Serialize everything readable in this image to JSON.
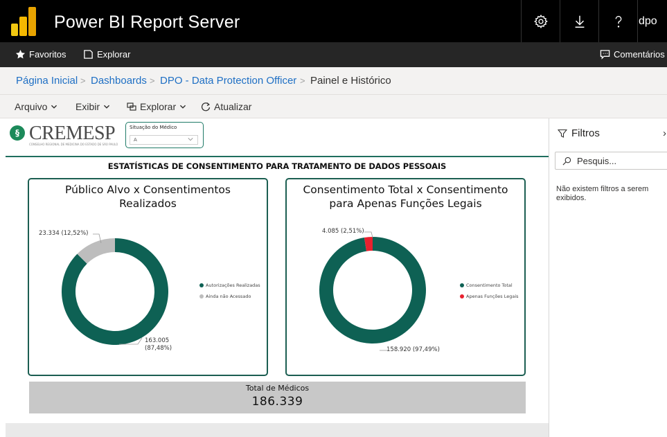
{
  "app": {
    "title": "Power BI Report Server",
    "user": "dpo"
  },
  "nav": {
    "favorites": "Favoritos",
    "explore": "Explorar",
    "comments": "Comentários"
  },
  "breadcrumb": {
    "home": "Página Inicial",
    "dashboards": "Dashboards",
    "folder": "DPO - Data Protection Officer",
    "current": "Painel e Histórico",
    "separator": ">"
  },
  "toolbar": {
    "file": "Arquivo",
    "view": "Exibir",
    "explore": "Explorar",
    "refresh": "Atualizar"
  },
  "report": {
    "logo_text": "CREMESP",
    "logo_subtitle": "CONSELHO REGIONAL DE MEDICINA DO ESTADO DE SÃO PAULO",
    "slicer": {
      "label": "Situação do Médico",
      "value": "A"
    },
    "title": "ESTATÍSTICAS DE CONSENTIMENTO PARA TRATAMENTO DE DADOS PESSOAIS",
    "total": {
      "label": "Total de Médicos",
      "value": "186.339"
    }
  },
  "chart_data": [
    {
      "type": "pie",
      "variant": "donut",
      "title_line1": "Público Alvo x Consentimentos",
      "title_line2": "Realizados",
      "categories": [
        "Autorizações Realizadas",
        "Ainda não Acessado"
      ],
      "values": [
        163005,
        23334
      ],
      "labels": [
        "163.005 (87,48%)",
        "23.334 (12,52%)"
      ],
      "label_lines": [
        [
          "163.005",
          "(87,48%)"
        ],
        [
          "23.334 (12,52%)"
        ]
      ],
      "colors": [
        "#0e6154",
        "#bdbdbd"
      ],
      "legend": "right"
    },
    {
      "type": "pie",
      "variant": "donut",
      "title_line1": "Consentimento Total x Consentimento",
      "title_line2": "para Apenas Funções Legais",
      "categories": [
        "Consentimento Total",
        "Apenas Funções Legais"
      ],
      "values": [
        158920,
        4085
      ],
      "labels": [
        "158.920 (97,49%)",
        "4.085 (2,51%)"
      ],
      "label_lines": [
        [
          "158.920 (97,49%)"
        ],
        [
          "4.085 (2,51%)"
        ]
      ],
      "colors": [
        "#0e6154",
        "#e8212f"
      ],
      "legend": "right"
    }
  ],
  "filters": {
    "title": "Filtros",
    "search_placeholder": "Pesquis...",
    "empty_message": "Não existem filtros a serem exibidos."
  },
  "colors": {
    "topbar": "#000000",
    "navbar": "#262626",
    "accent": "#0e6154",
    "link": "#1e6fc4"
  },
  "icons": [
    "power-bi-logo-icon",
    "gear-icon",
    "download-icon",
    "help-icon",
    "star-icon",
    "explore-icon",
    "comment-icon",
    "chevron-down-icon",
    "refresh-icon",
    "filter-icon",
    "search-icon"
  ]
}
